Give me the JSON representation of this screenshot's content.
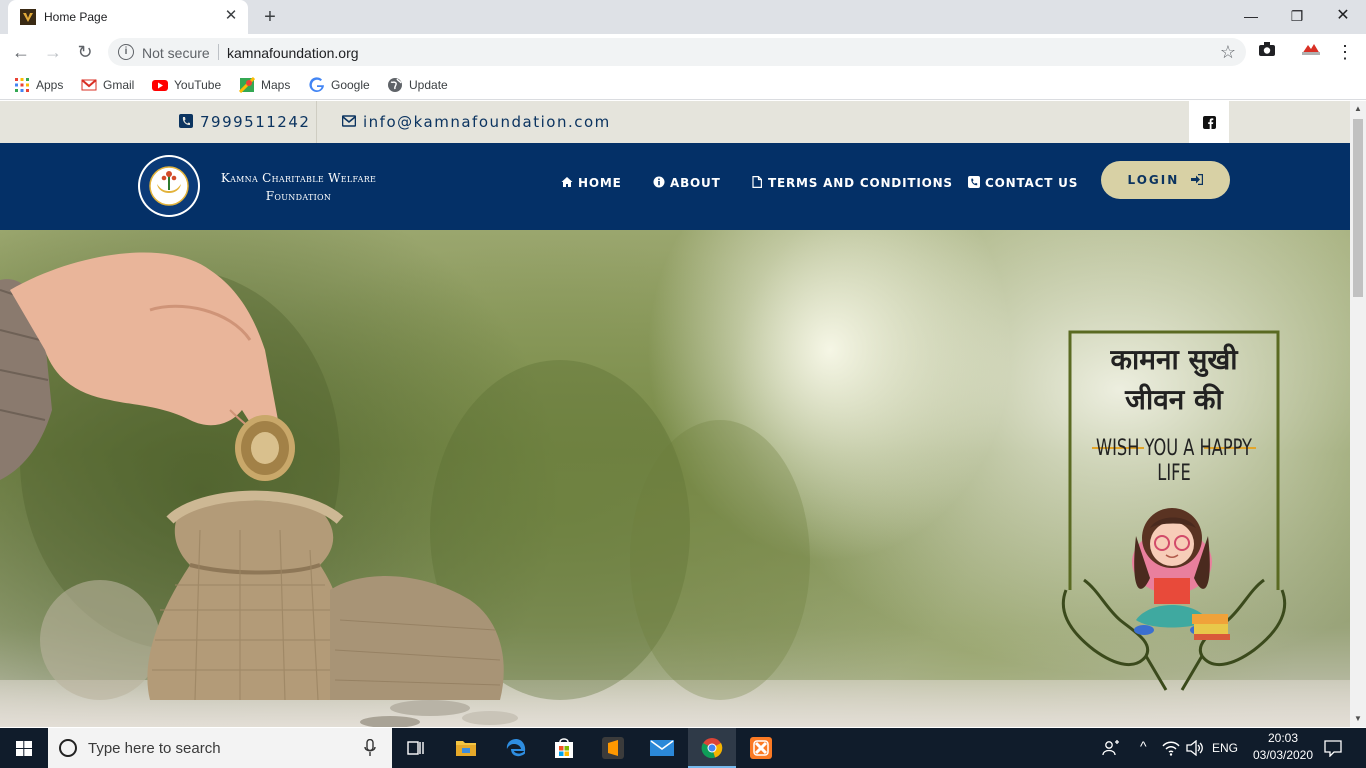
{
  "browser": {
    "tab_title": "Home Page",
    "security_label": "Not secure",
    "url": "kamnafoundation.org",
    "bookmarks": [
      {
        "label": "Apps",
        "icon": "apps-grid-icon"
      },
      {
        "label": "Gmail",
        "icon": "gmail-icon"
      },
      {
        "label": "YouTube",
        "icon": "youtube-icon"
      },
      {
        "label": "Maps",
        "icon": "maps-icon"
      },
      {
        "label": "Google",
        "icon": "google-icon"
      },
      {
        "label": "Update",
        "icon": "globe-icon"
      }
    ]
  },
  "site": {
    "phone": "7999511242",
    "email": "info@kamnafoundation.com",
    "brand_line1": "Kamna Charitable Welfare",
    "brand_line2": "Foundation",
    "nav": [
      {
        "label": "HOME",
        "icon": "home-icon"
      },
      {
        "label": "ABOUT",
        "icon": "info-circle-icon"
      },
      {
        "label": "TERMS AND CONDITIONS",
        "icon": "document-icon"
      },
      {
        "label": "CONTACT US",
        "icon": "phone-square-icon"
      }
    ],
    "login_label": "LOGIN",
    "hero": {
      "hindi_line1": "कामना सुखी",
      "hindi_line2": "जीवन की",
      "tagline": "WISH YOU A HAPPY LIFE"
    },
    "colors": {
      "navbar": "#043067",
      "topbar": "#e5e4dc",
      "login": "#d8d1a5",
      "text_dark": "#0c3460"
    }
  },
  "taskbar": {
    "search_placeholder": "Type here to search",
    "language": "ENG",
    "time": "20:03",
    "date": "03/03/2020"
  }
}
